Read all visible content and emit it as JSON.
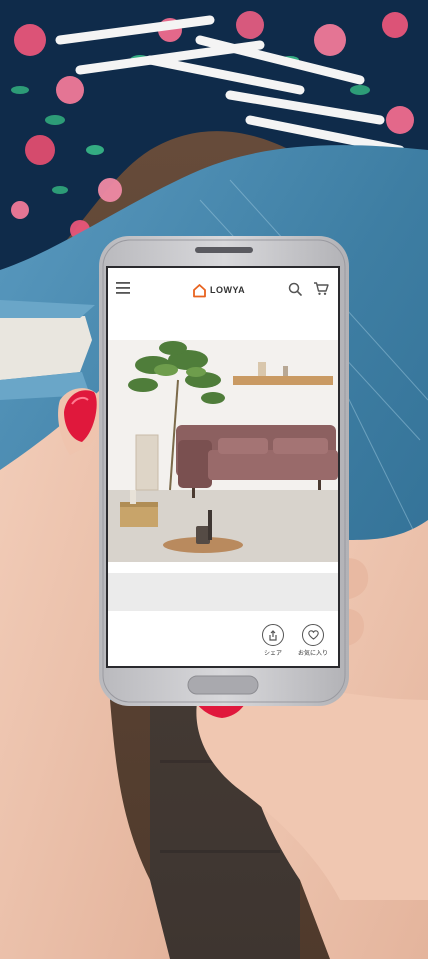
{
  "app": {
    "brand_name": "LOWYA",
    "brand_color": "#e8631f"
  },
  "header_icons": [
    "menu-icon",
    "search-icon",
    "cart-icon"
  ],
  "actions": [
    {
      "icon": "share-icon",
      "label": "シェア"
    },
    {
      "icon": "heart-icon",
      "label": "お気に入り"
    }
  ],
  "colors": {
    "nail_polish": "#e0183c",
    "denim": "#3e7ea3",
    "sofa": "#8c6060",
    "phone_body": "#c9c9cc"
  }
}
